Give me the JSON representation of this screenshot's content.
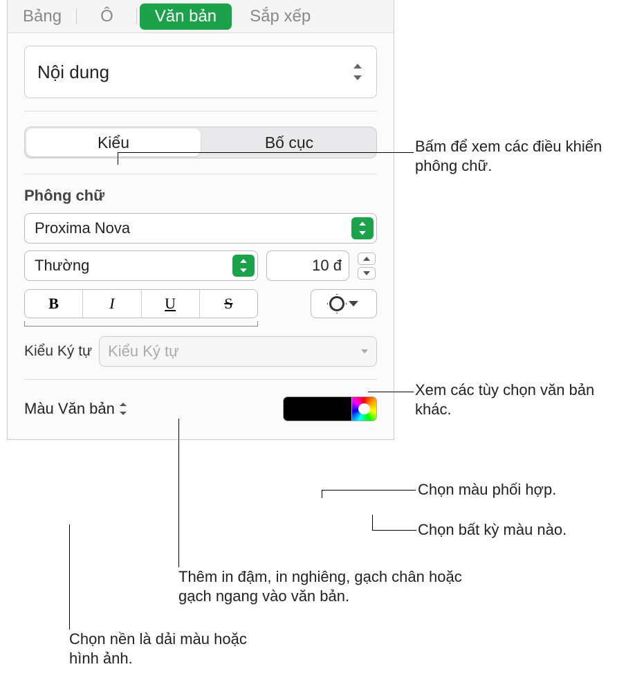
{
  "tabs": {
    "table": "Bảng",
    "cell": "Ô",
    "text": "Văn bản",
    "arrange": "Sắp xếp"
  },
  "paragraph_style": {
    "value": "Nội dung"
  },
  "segmented": {
    "style": "Kiểu",
    "layout": "Bố cục"
  },
  "font": {
    "heading": "Phông chữ",
    "family": "Proxima Nova",
    "weight": "Thường",
    "size": "10 đ"
  },
  "bius": {
    "bold": "B",
    "italic": "I",
    "underline": "U",
    "strike": "S"
  },
  "char_style": {
    "label": "Kiểu Ký tự",
    "placeholder": "Kiểu Ký tự"
  },
  "text_color": {
    "label": "Màu Văn bản",
    "swatch": "#000000"
  },
  "callouts": {
    "c1": "Bấm để xem các điều khiển phông chữ.",
    "c2": "Xem các tùy chọn văn bản khác.",
    "c3": "Chọn màu phối hợp.",
    "c4": "Chọn bất kỳ màu nào.",
    "c5": "Thêm in đậm, in nghiêng, gạch chân hoặc gạch ngang vào văn bản.",
    "c6": "Chọn nền là dải màu hoặc hình ảnh."
  }
}
